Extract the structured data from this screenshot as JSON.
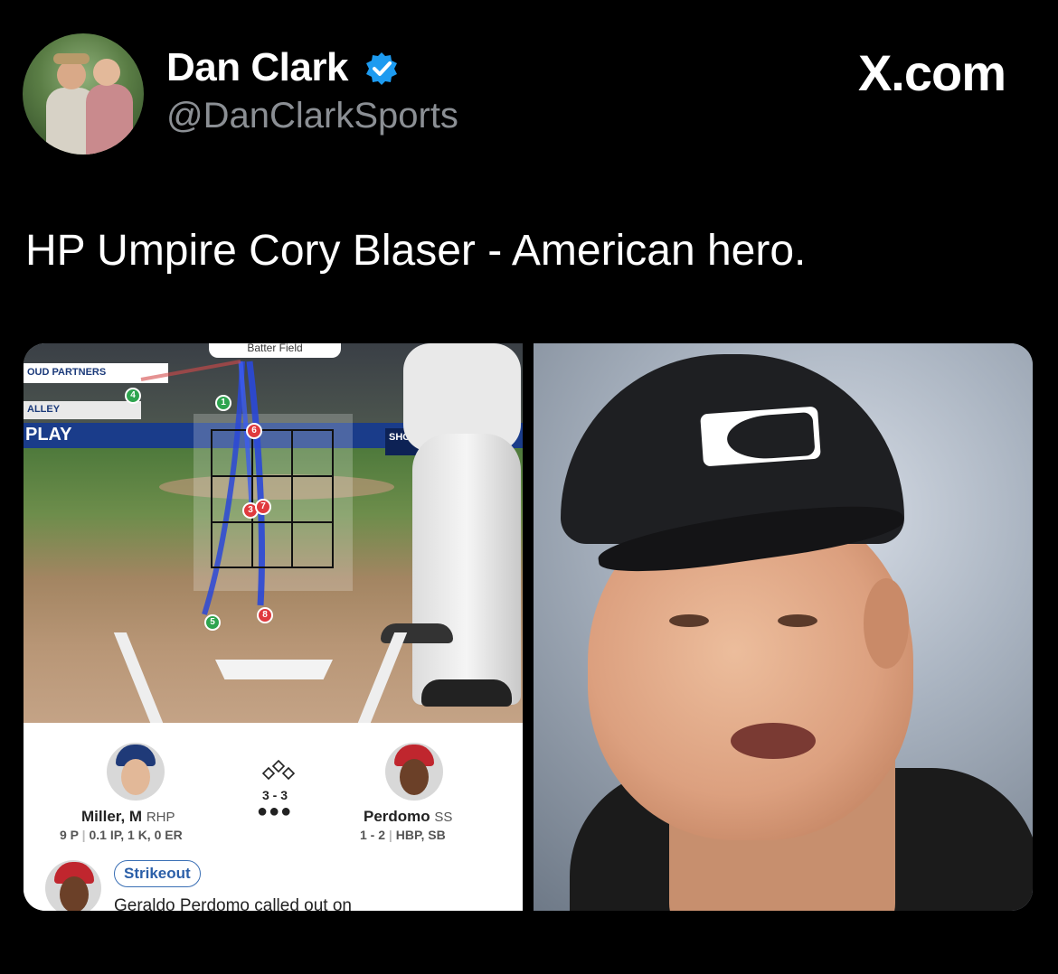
{
  "header": {
    "display_name": "Dan Clark",
    "handle": "@DanClarkSports",
    "verified_icon": "verified-badge-icon",
    "brand": "X.com"
  },
  "tweet": {
    "text": "HP Umpire Cory Blaser - American hero."
  },
  "left_image": {
    "tabs_label": "Batter   Field",
    "ads": {
      "ad1": "OUD PARTNERS",
      "ad2": "ALLEY",
      "ad3": "PLAY",
      "ad4": "SHOW2"
    },
    "pitches": [
      {
        "num": "1",
        "color": "#2ea44f"
      },
      {
        "num": "4",
        "color": "#2ea44f"
      },
      {
        "num": "6",
        "color": "#e03a3e"
      },
      {
        "num": "3",
        "color": "#e03a3e"
      },
      {
        "num": "7",
        "color": "#e03a3e"
      },
      {
        "num": "5",
        "color": "#2ea44f"
      },
      {
        "num": "8",
        "color": "#e03a3e"
      }
    ],
    "gameday": {
      "pitcher_name": "Miller, M",
      "pitcher_pos": "RHP",
      "pitcher_pitches": "9 P",
      "pitcher_line": "0.1 IP, 1 K, 0 ER",
      "count": "3 - 3",
      "outs": "●●●",
      "batter_name": "Perdomo",
      "batter_pos": "SS",
      "batter_hits": "1 - 2",
      "batter_line": "HBP, SB",
      "result_badge": "Strikeout",
      "result_text": "Geraldo Perdomo called out on"
    }
  }
}
